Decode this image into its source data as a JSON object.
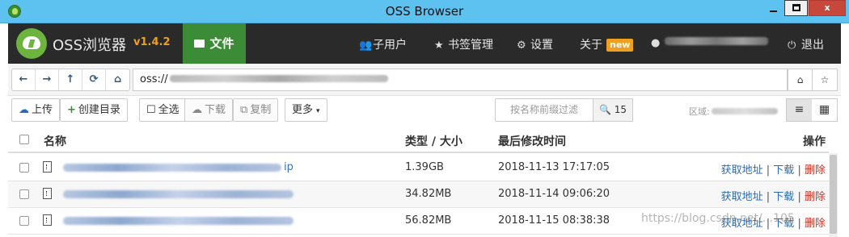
{
  "window": {
    "title": "OSS Browser",
    "minimize_icon": "minimize-icon",
    "maximize_icon": "maximize-icon",
    "close_glyph": "x"
  },
  "nav": {
    "brand": "OSS浏览器",
    "version": "v1.4.2",
    "files_tab": "文件",
    "subusers": "子用户",
    "bookmarks": "书签管理",
    "settings": "设置",
    "about": "关于",
    "about_badge": "new",
    "logout": "退出"
  },
  "address": {
    "prefix": "oss://"
  },
  "toolbar": {
    "upload": "上传",
    "create_dir": "创建目录",
    "select_all": "全选",
    "download": "下载",
    "copy": "复制",
    "more": "更多",
    "filter_placeholder": "按名称前缀过滤",
    "count": "15",
    "region_label": "区域:"
  },
  "table": {
    "headers": {
      "name": "名称",
      "type_size": "类型 / 大小",
      "modified": "最后修改时间",
      "ops": "操作"
    },
    "rows": [
      {
        "ext": "ip",
        "size": "1.39GB",
        "modified": "2018-11-13 17:17:05"
      },
      {
        "ext": "",
        "size": "34.82MB",
        "modified": "2018-11-14 09:06:20"
      },
      {
        "ext": "",
        "size": "56.82MB",
        "modified": "2018-11-15 08:38:38"
      }
    ],
    "ops": {
      "get_url": "获取地址",
      "download": "下载",
      "delete": "删除",
      "separator": "|"
    }
  },
  "watermark": "https://blog.csdn.net/...105",
  "colors": {
    "titlebar": "#5ec2f0",
    "navbar": "#2a2a2a",
    "active_tab": "#3c8b37",
    "version": "#f0a020",
    "link": "#2a6cb3",
    "delete": "#c0392b"
  }
}
